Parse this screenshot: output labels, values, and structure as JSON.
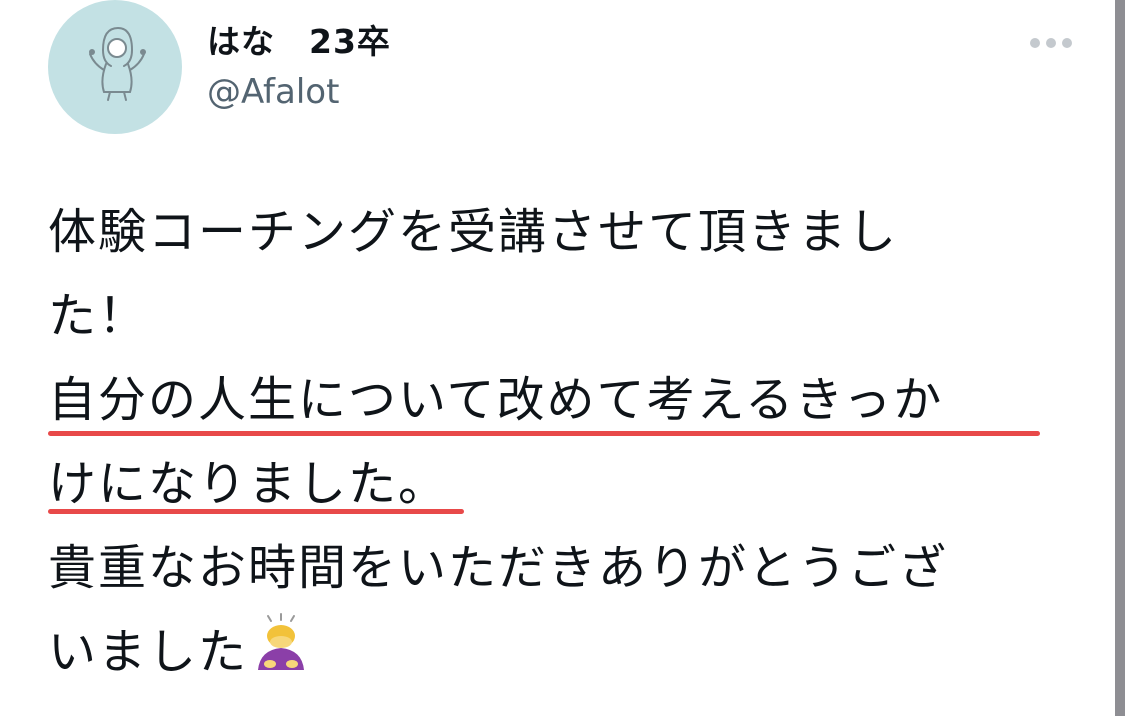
{
  "user": {
    "display_name": "はな　23卒",
    "handle": "@Afalot"
  },
  "tweet": {
    "lines": [
      "体験コーチングを受講させて頂きまし",
      "た！",
      "自分の人生について改めて考えるきっか",
      "けになりました。",
      "貴重なお時間をいただきありがとうござ",
      "いました"
    ],
    "emoji": "person-bowing-emoji",
    "highlight_color": "#e84949"
  },
  "icons": {
    "avatar": "avatar-illustration-icon",
    "more": "more-options-icon"
  },
  "colors": {
    "avatar_bg": "#c3e1e4",
    "handle": "#536471",
    "text": "#0f1419"
  }
}
